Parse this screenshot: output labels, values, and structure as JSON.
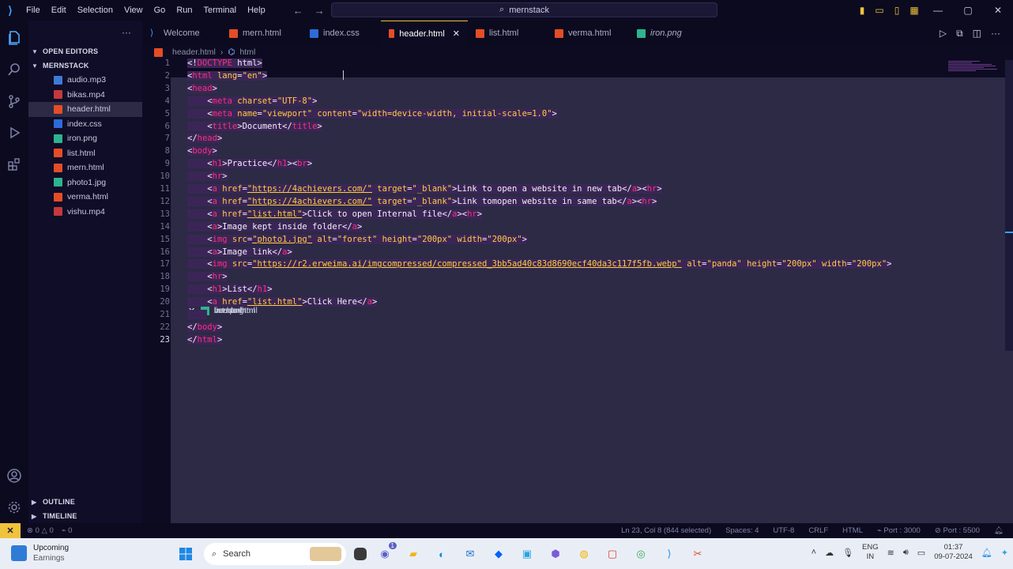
{
  "app": {
    "title_search": "mernstack",
    "menu": [
      "File",
      "Edit",
      "Selection",
      "View",
      "Go",
      "Run",
      "Terminal",
      "Help"
    ]
  },
  "sidebar": {
    "open_editors_label": "OPEN EDITORS",
    "open_editors": [
      {
        "name": "Welcome",
        "icon": "vscode"
      },
      {
        "name": "mern.html",
        "icon": "html"
      },
      {
        "name": "index.css",
        "icon": "css"
      },
      {
        "name": "header.html",
        "icon": "html",
        "selected": true,
        "close": "✕"
      },
      {
        "name": "list.html",
        "icon": "html"
      },
      {
        "name": "verma.html",
        "icon": "html"
      },
      {
        "name": "iron.png",
        "icon": "img",
        "italic": true
      }
    ],
    "workspace_label": "MERNSTACK",
    "files": [
      {
        "name": "audio.mp3",
        "icon": "mp3"
      },
      {
        "name": "bikas.mp4",
        "icon": "mp4"
      },
      {
        "name": "header.html",
        "icon": "html",
        "selected": true
      },
      {
        "name": "index.css",
        "icon": "css"
      },
      {
        "name": "iron.png",
        "icon": "img"
      },
      {
        "name": "list.html",
        "icon": "html"
      },
      {
        "name": "mern.html",
        "icon": "html"
      },
      {
        "name": "photo1.jpg",
        "icon": "img"
      },
      {
        "name": "verma.html",
        "icon": "html"
      },
      {
        "name": "vishu.mp4",
        "icon": "mp4"
      }
    ],
    "outline_label": "OUTLINE",
    "timeline_label": "TIMELINE"
  },
  "tabs": [
    {
      "label": "Welcome",
      "icon": "vscode"
    },
    {
      "label": "mern.html",
      "icon": "html"
    },
    {
      "label": "index.css",
      "icon": "css"
    },
    {
      "label": "header.html",
      "icon": "html",
      "active": true,
      "close": "✕"
    },
    {
      "label": "list.html",
      "icon": "html"
    },
    {
      "label": "verma.html",
      "icon": "html"
    },
    {
      "label": "iron.png",
      "icon": "img",
      "italic": true
    }
  ],
  "breadcrumb": {
    "file": "header.html",
    "node": "html"
  },
  "editor": {
    "current_line": 23,
    "lines": [
      [
        [
          "pu",
          "<!"
        ],
        [
          "tg",
          "DOCTYPE"
        ],
        [
          "tx",
          " html"
        ],
        [
          "pu",
          ">"
        ]
      ],
      [
        [
          "pu",
          "<"
        ],
        [
          "tg",
          "html"
        ],
        [
          "at",
          " lang"
        ],
        [
          "pu",
          "="
        ],
        [
          "st",
          "\"en\""
        ],
        [
          "pu",
          ">"
        ]
      ],
      [
        [
          "pu",
          "<"
        ],
        [
          "tg",
          "head"
        ],
        [
          "pu",
          ">"
        ]
      ],
      [
        [
          "tx",
          "    "
        ],
        [
          "pu",
          "<"
        ],
        [
          "tg",
          "meta"
        ],
        [
          "at",
          " charset"
        ],
        [
          "pu",
          "="
        ],
        [
          "st",
          "\"UTF-8\""
        ],
        [
          "pu",
          ">"
        ]
      ],
      [
        [
          "tx",
          "    "
        ],
        [
          "pu",
          "<"
        ],
        [
          "tg",
          "meta"
        ],
        [
          "at",
          " name"
        ],
        [
          "pu",
          "="
        ],
        [
          "st",
          "\"viewport\""
        ],
        [
          "at",
          " content"
        ],
        [
          "pu",
          "="
        ],
        [
          "st",
          "\"width=device-width, initial-scale=1.0\""
        ],
        [
          "pu",
          ">"
        ]
      ],
      [
        [
          "tx",
          "    "
        ],
        [
          "pu",
          "<"
        ],
        [
          "tg",
          "title"
        ],
        [
          "pu",
          ">"
        ],
        [
          "tx",
          "Document"
        ],
        [
          "pu",
          "</"
        ],
        [
          "tg",
          "title"
        ],
        [
          "pu",
          ">"
        ]
      ],
      [
        [
          "pu",
          "</"
        ],
        [
          "tg",
          "head"
        ],
        [
          "pu",
          ">"
        ]
      ],
      [
        [
          "pu",
          "<"
        ],
        [
          "tg",
          "body"
        ],
        [
          "pu",
          ">"
        ]
      ],
      [
        [
          "tx",
          "    "
        ],
        [
          "pu",
          "<"
        ],
        [
          "tg",
          "h1"
        ],
        [
          "pu",
          ">"
        ],
        [
          "tx",
          "Practice"
        ],
        [
          "pu",
          "</"
        ],
        [
          "tg",
          "h1"
        ],
        [
          "pu",
          "><"
        ],
        [
          "tg",
          "br"
        ],
        [
          "pu",
          ">"
        ]
      ],
      [
        [
          "tx",
          "    "
        ],
        [
          "pu",
          "<"
        ],
        [
          "tg",
          "hr"
        ],
        [
          "pu",
          ">"
        ]
      ],
      [
        [
          "tx",
          "    "
        ],
        [
          "pu",
          "<"
        ],
        [
          "tg",
          "a"
        ],
        [
          "at",
          " href"
        ],
        [
          "pu",
          "="
        ],
        [
          "st",
          "\"https://4achievers.com/\"",
          "ul"
        ],
        [
          "at",
          " target"
        ],
        [
          "pu",
          "="
        ],
        [
          "st",
          "\"_blank\""
        ],
        [
          "pu",
          ">"
        ],
        [
          "tx",
          "Link to open a website in new tab"
        ],
        [
          "pu",
          "</"
        ],
        [
          "tg",
          "a"
        ],
        [
          "pu",
          "><"
        ],
        [
          "tg",
          "hr"
        ],
        [
          "pu",
          ">"
        ]
      ],
      [
        [
          "tx",
          "    "
        ],
        [
          "pu",
          "<"
        ],
        [
          "tg",
          "a"
        ],
        [
          "at",
          " href"
        ],
        [
          "pu",
          "="
        ],
        [
          "st",
          "\"https://4achievers.com/\"",
          "ul"
        ],
        [
          "at",
          " target"
        ],
        [
          "pu",
          "="
        ],
        [
          "st",
          "\"_blank\""
        ],
        [
          "pu",
          ">"
        ],
        [
          "tx",
          "Link tomopen website in same tab"
        ],
        [
          "pu",
          "</"
        ],
        [
          "tg",
          "a"
        ],
        [
          "pu",
          "><"
        ],
        [
          "tg",
          "hr"
        ],
        [
          "pu",
          ">"
        ]
      ],
      [
        [
          "tx",
          "    "
        ],
        [
          "pu",
          "<"
        ],
        [
          "tg",
          "a"
        ],
        [
          "at",
          " href"
        ],
        [
          "pu",
          "="
        ],
        [
          "st",
          "\"list.html\"",
          "ul"
        ],
        [
          "pu",
          ">"
        ],
        [
          "tx",
          "Click to open Internal file"
        ],
        [
          "pu",
          "</"
        ],
        [
          "tg",
          "a"
        ],
        [
          "pu",
          "><"
        ],
        [
          "tg",
          "hr"
        ],
        [
          "pu",
          ">"
        ]
      ],
      [
        [
          "tx",
          "    "
        ],
        [
          "pu",
          "<"
        ],
        [
          "tg",
          "a"
        ],
        [
          "pu",
          ">"
        ],
        [
          "tx",
          "Image kept inside folder"
        ],
        [
          "pu",
          "</"
        ],
        [
          "tg",
          "a"
        ],
        [
          "pu",
          ">"
        ]
      ],
      [
        [
          "tx",
          "    "
        ],
        [
          "pu",
          "<"
        ],
        [
          "tg",
          "img"
        ],
        [
          "at",
          " src"
        ],
        [
          "pu",
          "="
        ],
        [
          "st",
          "\"photo1.jpg\"",
          "ul"
        ],
        [
          "at",
          " alt"
        ],
        [
          "pu",
          "="
        ],
        [
          "st",
          "\"forest\""
        ],
        [
          "at",
          " height"
        ],
        [
          "pu",
          "="
        ],
        [
          "st",
          "\"200px\""
        ],
        [
          "at",
          " width"
        ],
        [
          "pu",
          "="
        ],
        [
          "st",
          "\"200px\""
        ],
        [
          "pu",
          ">"
        ]
      ],
      [
        [
          "tx",
          "    "
        ],
        [
          "pu",
          "<"
        ],
        [
          "tg",
          "a"
        ],
        [
          "pu",
          ">"
        ],
        [
          "tx",
          "Image link"
        ],
        [
          "pu",
          "</"
        ],
        [
          "tg",
          "a"
        ],
        [
          "pu",
          ">"
        ]
      ],
      [
        [
          "tx",
          "    "
        ],
        [
          "pu",
          "<"
        ],
        [
          "tg",
          "img"
        ],
        [
          "at",
          " src"
        ],
        [
          "pu",
          "="
        ],
        [
          "st",
          "\"https://r2.erweima.ai/imgcompressed/compressed_3bb5ad40c83d8690ecf40da3c117f5fb.webp\"",
          "ul"
        ],
        [
          "at",
          " alt"
        ],
        [
          "pu",
          "="
        ],
        [
          "st",
          "\"panda\""
        ],
        [
          "at",
          " height"
        ],
        [
          "pu",
          "="
        ],
        [
          "st",
          "\"200px\""
        ],
        [
          "at",
          " width"
        ],
        [
          "pu",
          "="
        ],
        [
          "st",
          "\"200px\""
        ],
        [
          "pu",
          ">"
        ]
      ],
      [
        [
          "tx",
          "    "
        ],
        [
          "pu",
          "<"
        ],
        [
          "tg",
          "hr"
        ],
        [
          "pu",
          ">"
        ]
      ],
      [
        [
          "tx",
          "    "
        ],
        [
          "pu",
          "<"
        ],
        [
          "tg",
          "h1"
        ],
        [
          "pu",
          ">"
        ],
        [
          "tx",
          "List"
        ],
        [
          "pu",
          "</"
        ],
        [
          "tg",
          "h1"
        ],
        [
          "pu",
          ">"
        ]
      ],
      [
        [
          "tx",
          "    "
        ],
        [
          "pu",
          "<"
        ],
        [
          "tg",
          "a"
        ],
        [
          "at",
          " href"
        ],
        [
          "pu",
          "="
        ],
        [
          "st",
          "\"list.html\"",
          "ul"
        ],
        [
          "pu",
          ">"
        ],
        [
          "tx",
          "Click Here"
        ],
        [
          "pu",
          "</"
        ],
        [
          "tg",
          "a"
        ],
        [
          "pu",
          ">"
        ]
      ],
      [
        [
          "tx",
          "    "
        ]
      ],
      [
        [
          "pu",
          "</"
        ],
        [
          "tg",
          "body"
        ],
        [
          "pu",
          ">"
        ]
      ],
      [
        [
          "pu",
          "</"
        ],
        [
          "tg",
          "html"
        ],
        [
          "pu",
          ">"
        ]
      ]
    ]
  },
  "status": {
    "errors": "0",
    "warnings": "0",
    "ports": "0",
    "position": "Ln 23, Col 8 (844 selected)",
    "spaces": "Spaces: 4",
    "encoding": "UTF-8",
    "eol": "CRLF",
    "language": "HTML",
    "port": "Port : 3000",
    "port2": "Port : 5500"
  },
  "taskbar": {
    "weather_title": "Upcoming",
    "weather_sub": "Earnings",
    "search": "Search",
    "lang_top": "ENG",
    "lang_bottom": "IN",
    "time": "01:37",
    "date": "09-07-2024",
    "chat_badge": "1"
  },
  "colors": {
    "accent": "#f0c33c",
    "tag": "#ff2d7a",
    "string": "#ffcf3a",
    "bg": "#0d0b22"
  }
}
